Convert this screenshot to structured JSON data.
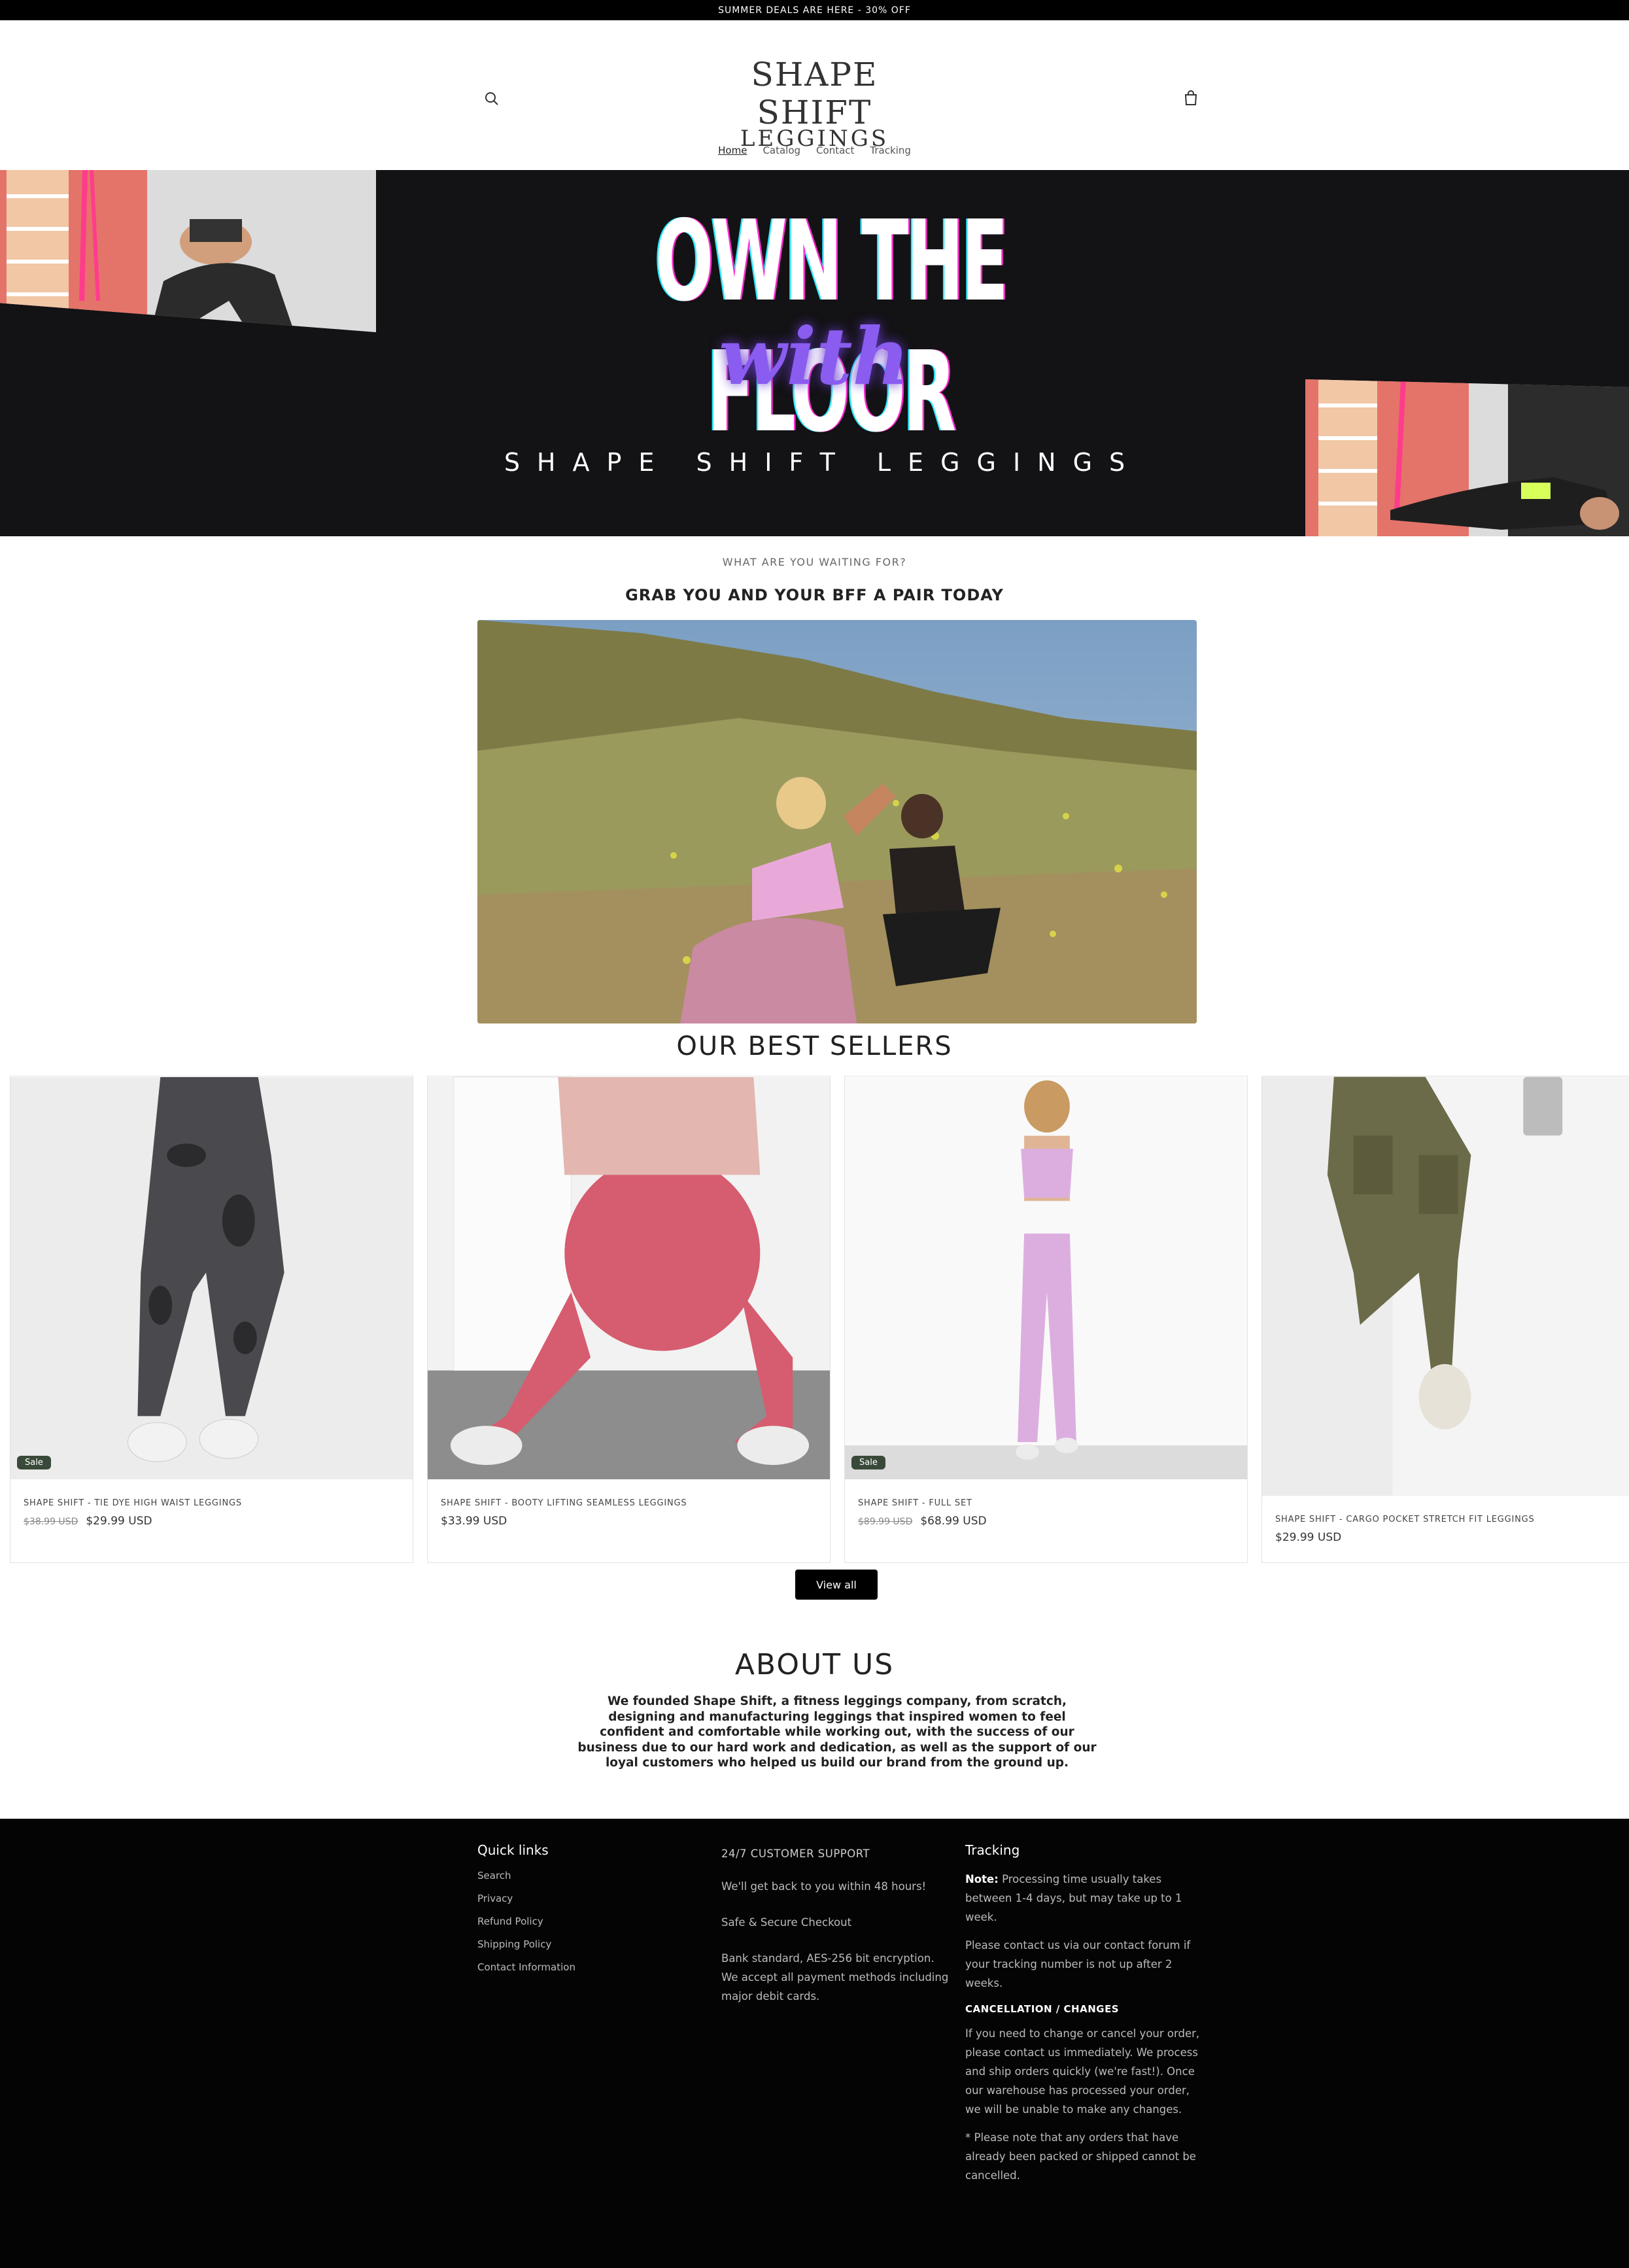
{
  "announcement": "SUMMER DEALS ARE HERE - 30% OFF",
  "header": {
    "logo_line1": "SHAPE SHIFT",
    "logo_line2": "LEGGINGS",
    "nav": [
      "Home",
      "Catalog",
      "Contact",
      "Tracking"
    ],
    "search_icon": "search-icon",
    "cart_icon": "cart-icon"
  },
  "hero": {
    "title": "OWN THE FLOOR",
    "with": "with",
    "subtitle": "SHAPE SHIFT LEGGINGS"
  },
  "promo": {
    "kicker": "WHAT ARE YOU WAITING FOR?",
    "heading": "GRAB YOU AND YOUR BFF A PAIR TODAY"
  },
  "best_sellers": {
    "title": "OUR BEST SELLERS",
    "products": [
      {
        "name": "SHAPE SHIFT - TIE DYE HIGH WAIST LEGGINGS",
        "old_price": "$38.99 USD",
        "price": "$29.99 USD",
        "badge": "Sale"
      },
      {
        "name": "SHAPE SHIFT - BOOTY LIFTING SEAMLESS LEGGINGS",
        "old_price": "",
        "price": "$33.99 USD",
        "badge": ""
      },
      {
        "name": "SHAPE SHIFT - FULL SET",
        "old_price": "$89.99 USD",
        "price": "$68.99 USD",
        "badge": "Sale"
      },
      {
        "name": "SHAPE SHIFT - CARGO POCKET STRETCH FIT LEGGINGS",
        "old_price": "",
        "price": "$29.99 USD",
        "badge": ""
      }
    ],
    "view_all": "View all"
  },
  "about": {
    "title": "ABOUT US",
    "text": "We founded Shape Shift, a fitness leggings company, from scratch, designing and manufacturing leggings that inspired women to feel confident and comfortable while working out, with the success of our business due to our hard work and dedication, as well as the support of our loyal customers who helped us build our brand from the ground up."
  },
  "footer": {
    "quick_links_title": "Quick links",
    "quick_links": [
      "Search",
      "Privacy",
      "Refund Policy",
      "Shipping Policy",
      "Contact Information"
    ],
    "support_title": "24/7 CUSTOMER SUPPORT",
    "support_1": "We'll get back to you within 48 hours!",
    "support_2": "Safe & Secure Checkout",
    "support_3": "Bank standard, AES-256 bit encryption. We accept all payment methods including major debit cards.",
    "tracking_title": "Tracking",
    "note_label": "Note:",
    "note_text": " Processing time usually takes between 1-4 days, but may take up to 1 week.",
    "contact_text": "Please contact us via our contact forum if your tracking number is not up after 2 weeks.",
    "cancel_title": "CANCELLATION / CHANGES",
    "cancel_text": "If you need to change or cancel your order, please contact us immediately. We process and ship orders quickly (we're fast!). Once our warehouse has processed your order, we will be unable to make any changes.",
    "cancel_note": "* Please note that any orders that have already been packed or shipped cannot be cancelled."
  }
}
